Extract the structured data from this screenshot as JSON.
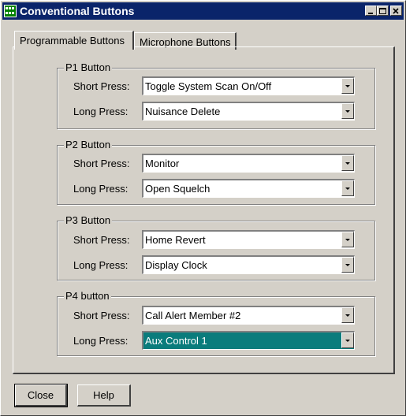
{
  "window": {
    "title": "Conventional Buttons"
  },
  "tabs": [
    {
      "label": "Programmable Buttons",
      "active": true
    },
    {
      "label": "Microphone Buttons",
      "active": false
    }
  ],
  "groups": [
    {
      "title": "P1 Button",
      "short_label": "Short Press:",
      "short_value": "Toggle System Scan On/Off",
      "long_label": "Long Press:",
      "long_value": "Nuisance Delete"
    },
    {
      "title": "P2 Button",
      "short_label": "Short Press:",
      "short_value": "Monitor",
      "long_label": "Long Press:",
      "long_value": "Open Squelch"
    },
    {
      "title": "P3 Button",
      "short_label": "Short Press:",
      "short_value": "Home Revert",
      "long_label": "Long Press:",
      "long_value": "Display Clock"
    },
    {
      "title": "P4 button",
      "short_label": "Short Press:",
      "short_value": "Call Alert Member #2",
      "long_label": "Long Press:",
      "long_value": "Aux Control 1"
    }
  ],
  "buttons": {
    "close": "Close",
    "help": "Help"
  },
  "colors": {
    "titlebar": "#0a246a",
    "selection": "#0a7c7c",
    "face": "#d4d0c8"
  }
}
